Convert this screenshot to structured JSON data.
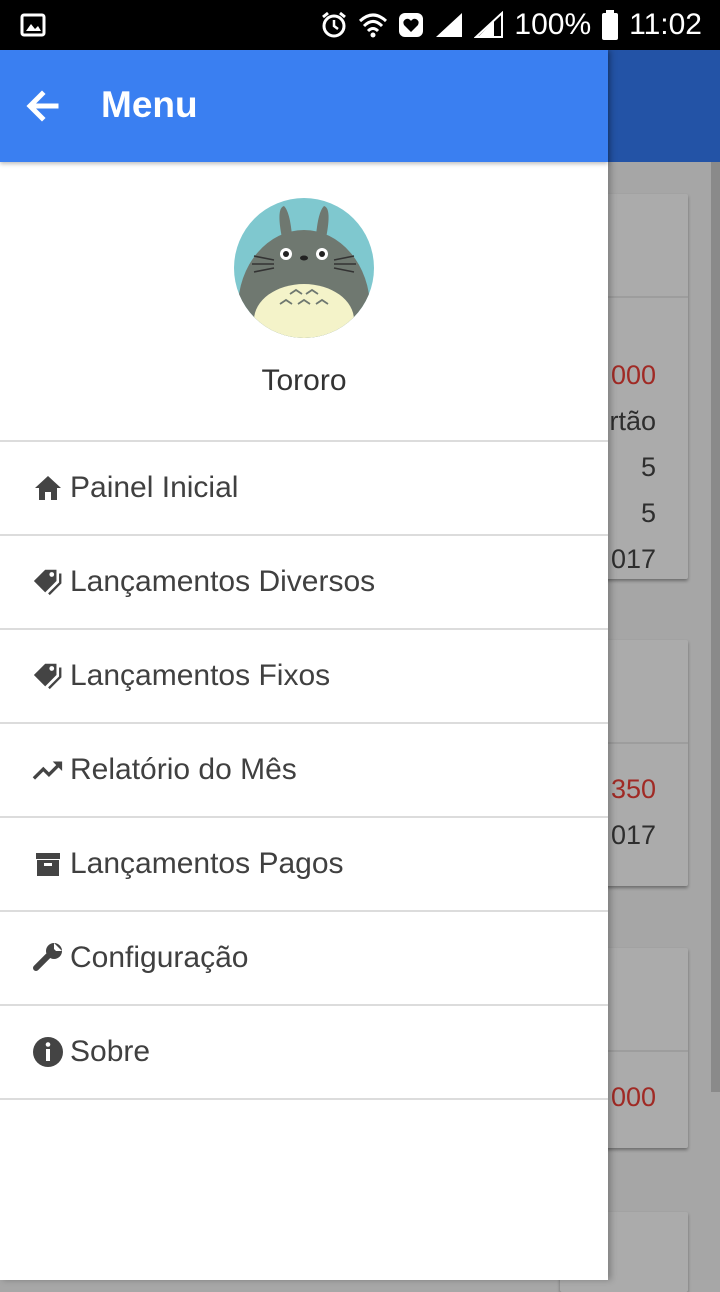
{
  "status_bar": {
    "battery": "100%",
    "time": "11:02"
  },
  "drawer": {
    "title": "Menu",
    "user_name": "Tororo",
    "items": [
      {
        "label": "Painel Inicial",
        "icon": "home-icon"
      },
      {
        "label": "Lançamentos Diversos",
        "icon": "tag-icon"
      },
      {
        "label": "Lançamentos Fixos",
        "icon": "tag-icon"
      },
      {
        "label": "Relatório do Mês",
        "icon": "trending-up-icon"
      },
      {
        "label": "Lançamentos Pagos",
        "icon": "archive-icon"
      },
      {
        "label": "Configuração",
        "icon": "wrench-icon"
      },
      {
        "label": "Sobre",
        "icon": "info-icon"
      }
    ]
  },
  "background": {
    "card1": {
      "amount": "000",
      "line2": "rtão",
      "line3": "5",
      "line4": "5",
      "line5": "017"
    },
    "card2": {
      "amount": "350",
      "line2": "017"
    },
    "card3": {
      "amount": "000"
    }
  },
  "colors": {
    "primary": "#3a7ff1",
    "primary_dim": "#2353a6",
    "negative": "#a02a25"
  }
}
